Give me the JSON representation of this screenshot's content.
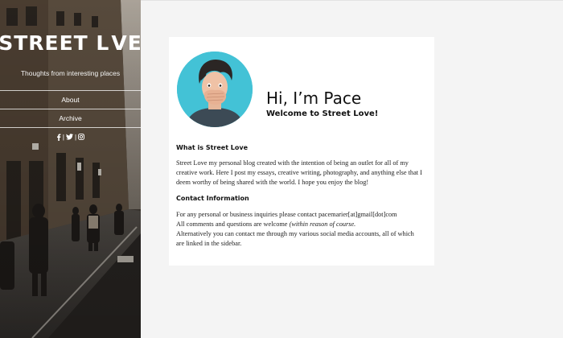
{
  "sidebar": {
    "brand_part1": "STREET L",
    "brand_part2": "VE",
    "brand_icon": "heart-icon",
    "tagline": "Thoughts from interesting places",
    "nav": [
      {
        "label": "About"
      },
      {
        "label": "Archive"
      }
    ],
    "social": [
      {
        "icon": "facebook-icon"
      },
      {
        "separator": "|"
      },
      {
        "icon": "twitter-icon"
      },
      {
        "separator": "|"
      },
      {
        "icon": "instagram-icon"
      }
    ]
  },
  "profile": {
    "greeting": "Hi, I’m Pace",
    "welcome": "Welcome to Street Love!",
    "avatar_bg": "#43c2d6"
  },
  "about": {
    "heading": "What is Street Love",
    "lines": [
      "Street Love my personal blog created with the intention of being an outlet for all of my",
      "creative work. Here I post my essays, creative writing, photography, and anything else that I",
      "deem worthy of being shared with the world. I hope you enjoy the blog!"
    ]
  },
  "contact": {
    "heading": "Contact Information",
    "line1": "For any personal or business inquiries please contact pacemarier[at]gmail[dot]com",
    "line2_plain": "All comments and questions are welcome ",
    "line2_italic": "(within reason of course.",
    "line3": "Alternatively you can contact me through my various social media accounts, all of which",
    "line4": "are linked in the sidebar."
  },
  "colors": {
    "page_bg": "#f4f4f4",
    "card_bg": "#ffffff",
    "accent_cyan": "#43c2d6"
  }
}
